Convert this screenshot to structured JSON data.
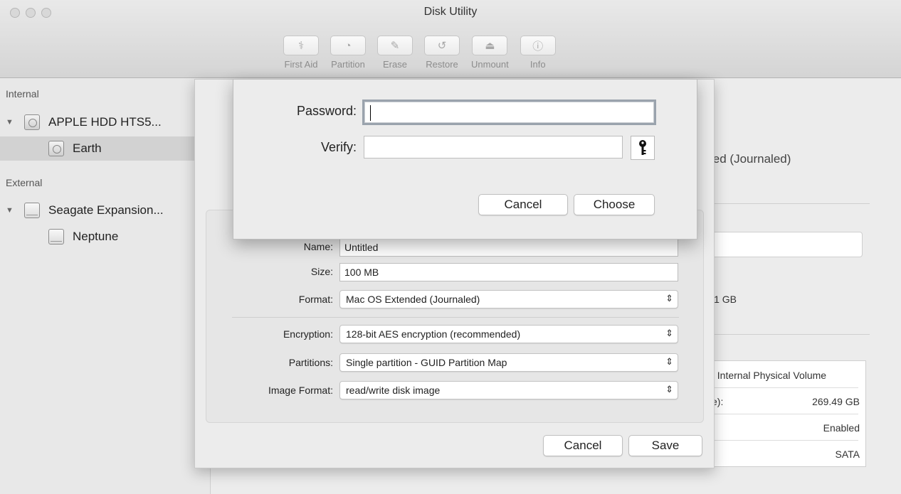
{
  "window": {
    "title": "Disk Utility"
  },
  "toolbar": {
    "items": [
      {
        "label": "First Aid",
        "glyph": "⚕"
      },
      {
        "label": "Partition",
        "glyph": "◔"
      },
      {
        "label": "Erase",
        "glyph": "✎"
      },
      {
        "label": "Restore",
        "glyph": "↺"
      },
      {
        "label": "Unmount",
        "glyph": "⏏"
      },
      {
        "label": "Info",
        "glyph": "ⓘ"
      }
    ]
  },
  "sidebar": {
    "internal_label": "Internal",
    "external_label": "External",
    "internal_disk": "APPLE HDD HTS5...",
    "internal_volume": "Earth",
    "external_disk": "Seagate Expansion...",
    "external_volume": "Neptune"
  },
  "background": {
    "format_text": "led (Journaled)",
    "capacity_text": "l1 GB",
    "table": {
      "row1": "\\ Internal Physical Volume",
      "row2_label": "e):",
      "row2_value": "269.49 GB",
      "row3_value": "Enabled",
      "row4_value": "SATA"
    }
  },
  "save_sheet": {
    "name_label": "Name:",
    "name_value": "Untitled",
    "size_label": "Size:",
    "size_value": "100 MB",
    "format_label": "Format:",
    "format_value": "Mac OS Extended (Journaled)",
    "encryption_label": "Encryption:",
    "encryption_value": "128-bit AES encryption (recommended)",
    "partitions_label": "Partitions:",
    "partitions_value": "Single partition - GUID Partition Map",
    "image_format_label": "Image Format:",
    "image_format_value": "read/write disk image",
    "cancel_label": "Cancel",
    "save_label": "Save"
  },
  "password_dialog": {
    "password_label": "Password:",
    "password_value": "",
    "verify_label": "Verify:",
    "verify_value": "",
    "cancel_label": "Cancel",
    "choose_label": "Choose"
  }
}
